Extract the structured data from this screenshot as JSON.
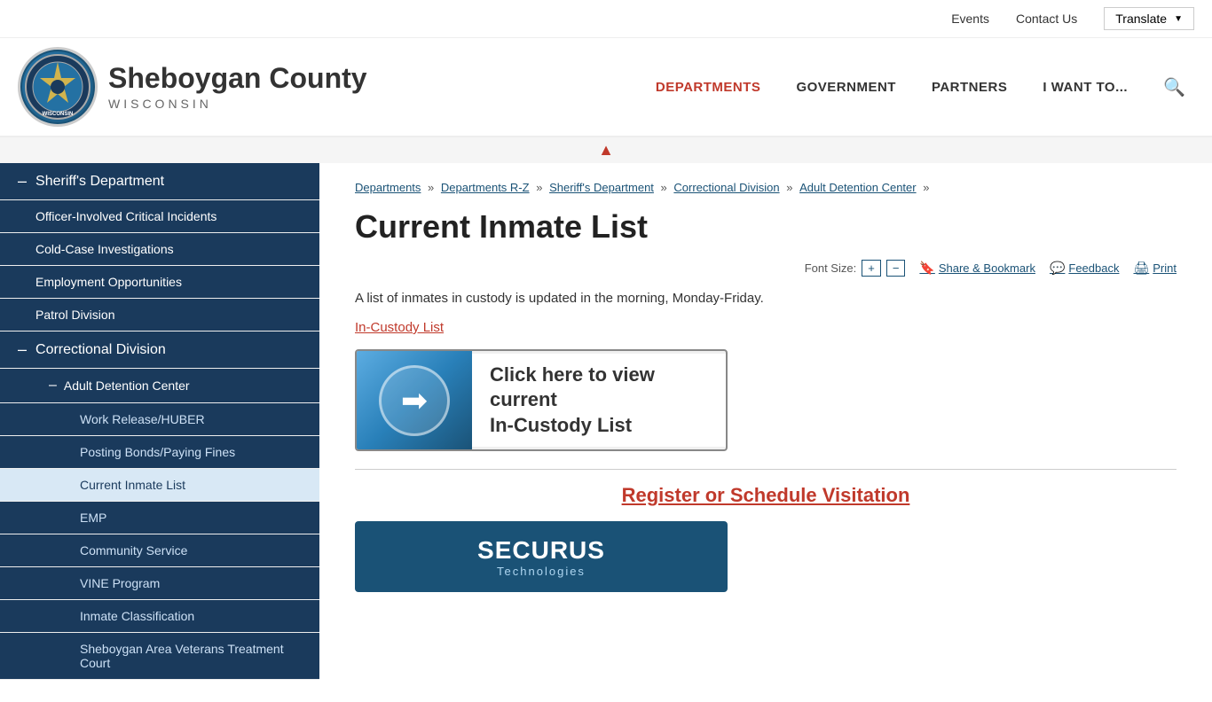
{
  "topbar": {
    "events_label": "Events",
    "contact_label": "Contact Us",
    "translate_label": "Translate"
  },
  "header": {
    "site_name": "Sheboygan County",
    "site_state": "WISCONSIN",
    "logo_text": "SHEBOYGAN COUNTY WISCONSIN",
    "nav": [
      {
        "id": "departments",
        "label": "DEPARTMENTS",
        "active": true
      },
      {
        "id": "government",
        "label": "GOVERNMENT",
        "active": false
      },
      {
        "id": "partners",
        "label": "PARTNERS",
        "active": false
      },
      {
        "id": "i-want-to",
        "label": "I WANT TO...",
        "active": false
      }
    ]
  },
  "sidebar": {
    "items": [
      {
        "id": "sheriffs-dept",
        "label": "Sheriff's Department",
        "level": 0,
        "dash": true
      },
      {
        "id": "officer-incidents",
        "label": "Officer-Involved Critical Incidents",
        "level": 1
      },
      {
        "id": "cold-case",
        "label": "Cold-Case Investigations",
        "level": 1
      },
      {
        "id": "employment",
        "label": "Employment Opportunities",
        "level": 1
      },
      {
        "id": "patrol",
        "label": "Patrol Division",
        "level": 1
      },
      {
        "id": "correctional",
        "label": "Correctional Division",
        "level": 0,
        "dash": true
      },
      {
        "id": "adult-detention",
        "label": "Adult Detention Center",
        "level": 2,
        "dash": true
      },
      {
        "id": "work-release",
        "label": "Work Release/HUBER",
        "level": 3
      },
      {
        "id": "posting-bonds",
        "label": "Posting Bonds/Paying Fines",
        "level": 3
      },
      {
        "id": "current-inmate",
        "label": "Current Inmate List",
        "level": 3,
        "active": true
      },
      {
        "id": "emp",
        "label": "EMP",
        "level": 3
      },
      {
        "id": "community-service",
        "label": "Community Service",
        "level": 3
      },
      {
        "id": "vine-program",
        "label": "VINE Program",
        "level": 3
      },
      {
        "id": "inmate-classification",
        "label": "Inmate Classification",
        "level": 3
      },
      {
        "id": "veterans-court",
        "label": "Sheboygan Area Veterans Treatment Court",
        "level": 3
      }
    ]
  },
  "breadcrumb": {
    "items": [
      {
        "label": "Departments",
        "link": true
      },
      {
        "label": "Departments R-Z",
        "link": true
      },
      {
        "label": "Sheriff's Department",
        "link": true
      },
      {
        "label": "Correctional Division",
        "link": true
      },
      {
        "label": "Adult Detention Center",
        "link": true
      }
    ]
  },
  "page": {
    "title": "Current Inmate List",
    "font_size_label": "Font Size:",
    "font_increase": "+",
    "font_decrease": "−",
    "share_label": "Share & Bookmark",
    "feedback_label": "Feedback",
    "print_label": "Print",
    "body_text": "A list of inmates in custody is updated in the morning, Monday-Friday.",
    "in_custody_link": "In-Custody List",
    "banner_line1": "Click here to view current",
    "banner_line2": "In-Custody List",
    "visitation_link": "Register or Schedule Visitation",
    "securus_main": "SECURUS",
    "securus_sub": "Technologies"
  }
}
